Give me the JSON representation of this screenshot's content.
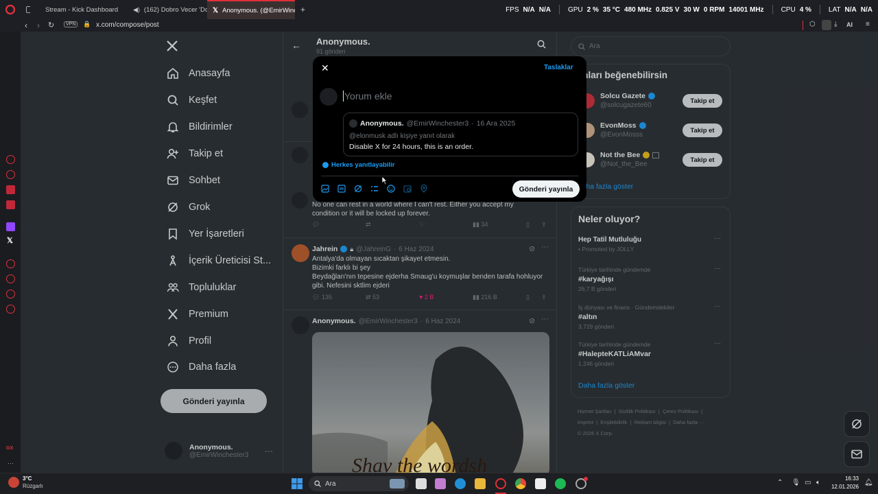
{
  "browser": {
    "tabs": [
      {
        "label": "Stream - Kick Dashboard",
        "icon": "kick-icon",
        "active": false
      },
      {
        "label": "(162) Dobro Vecer 'Do",
        "icon": "youtube-icon",
        "active": false
      },
      {
        "label": "Anonymous. (@EmirWinch",
        "icon": "x-icon",
        "active": true
      }
    ],
    "new_tab": "+",
    "url": "x.com/compose/post",
    "vpn": "VPN",
    "stats": {
      "fps_label": "FPS",
      "fps_value": "N/A",
      "fps_value2": "N/A",
      "gpu_label": "GPU",
      "gpu_load": "2 %",
      "gpu_temp": "35 °C",
      "gpu_clock": "480 MHz",
      "gpu_volt": "0.825 V",
      "gpu_power": "30 W",
      "gpu_fan": "0 RPM",
      "gpu_mem": "14001 MHz",
      "cpu_label": "CPU",
      "cpu_load": "4 %",
      "lat_label": "LAT",
      "lat_value": "N/A",
      "lat_value2": "N/A"
    },
    "ai_label": "AI"
  },
  "nav": {
    "items": [
      {
        "label": "Anasayfa",
        "icon": "home-icon"
      },
      {
        "label": "Keşfet",
        "icon": "search-icon"
      },
      {
        "label": "Bildirimler",
        "icon": "bell-icon"
      },
      {
        "label": "Takip et",
        "icon": "add-user-icon"
      },
      {
        "label": "Sohbet",
        "icon": "mail-icon"
      },
      {
        "label": "Grok",
        "icon": "grok-icon"
      },
      {
        "label": "Yer İşaretleri",
        "icon": "bookmark-icon"
      },
      {
        "label": "İçerik Üreticisi St...",
        "icon": "creator-icon"
      },
      {
        "label": "Topluluklar",
        "icon": "communities-icon"
      },
      {
        "label": "Premium",
        "icon": "x-icon"
      },
      {
        "label": "Profil",
        "icon": "profile-icon"
      },
      {
        "label": "Daha fazla",
        "icon": "more-icon"
      }
    ],
    "post_button": "Gönderi yayınla",
    "account_name": "Anonymous.",
    "account_handle": "@EmirWinchester3"
  },
  "feed": {
    "header_title": "Anonymous.",
    "header_sub": "91 gönderi",
    "partial_tweet_text_1": "No one can rest in a world where I can't rest. Either you accept my",
    "partial_tweet_text_2": "condition or it will be locked up forever.",
    "partial_views": "34",
    "tweet1": {
      "name": "Jahrein",
      "handle": "@JahreinG",
      "date": "6 Haz 2024",
      "lines": [
        "Antalya'da olmayan sıcaktan şikayet etmesin.",
        "Bizimki farklı bi şey",
        "Beydağları'nın tepesine ejderha Smaug'u koymuşlar benden tarafa hohluyor",
        "gibi. Nefesini sktlim ejderi"
      ],
      "replies": "135",
      "reposts": "53",
      "likes": "2 B",
      "views": "216 B"
    },
    "tweet2": {
      "name": "Anonymous.",
      "handle": "@EmirWinchester3",
      "date": "6 Haz 2024",
      "image_caption": "Shav the wordsh"
    }
  },
  "right": {
    "search_placeholder": "Ara",
    "who_title": "unları beğenebilirsin",
    "who": [
      {
        "name": "Solcu Gazete",
        "handle": "@solcugazete60",
        "button": "Takip et"
      },
      {
        "name": "EvonMoss",
        "handle": "@EvonMosss",
        "button": "Takip et"
      },
      {
        "name": "Not the Bee",
        "handle": "@Not_the_Bee",
        "button": "Takip et"
      }
    ],
    "who_more": "Daha fazla göster",
    "trends_title": "Neler oluyor?",
    "trends": [
      {
        "meta": "",
        "topic": "Hep Tatil Mutluluğu",
        "sub": "Promoted by JOLLY"
      },
      {
        "meta": "Türkiye tarihinde gündemde",
        "topic": "#karyağışı",
        "sub": "26,7 B gönderi"
      },
      {
        "meta": "İş dünyası ve finans · Gündemdekiler",
        "topic": "#altın",
        "sub": "3.729 gönderi"
      },
      {
        "meta": "Türkiye tarihinde gündemde",
        "topic": "#HalepteKATLiAMvar",
        "sub": "1.246 gönderi"
      }
    ],
    "trends_more": "Daha fazla göster",
    "footer": [
      "Hizmet Şartları",
      "Gizlilik Politikası",
      "Çerez Politikası",
      "Imprint",
      "Erişilebilirlik",
      "Reklam bilgisi",
      "Daha fazla ···",
      "© 2026 X Corp."
    ]
  },
  "modal": {
    "drafts": "Taslaklar",
    "placeholder": "Yorum ekle",
    "quoted_name": "Anonymous.",
    "quoted_handle": "@EmirWinchester3",
    "quoted_date": "16 Ara 2025",
    "quoted_reply_to": "@elonmusk adlı kişiye yanıt olarak",
    "quoted_text": "Disable X for 24 hours, this is an order.",
    "reply_setting": "Herkes yanıtlayabilir",
    "post_button": "Gönderi yayınla"
  },
  "taskbar": {
    "weather_temp": "3°C",
    "weather_desc": "Rüzgarlı",
    "search": "Ara",
    "time": "16:33",
    "date": "12.01.2026"
  },
  "colors": {
    "accent": "#1d9bf0",
    "opera_red": "#e0303a",
    "like_pink": "#f91880"
  }
}
